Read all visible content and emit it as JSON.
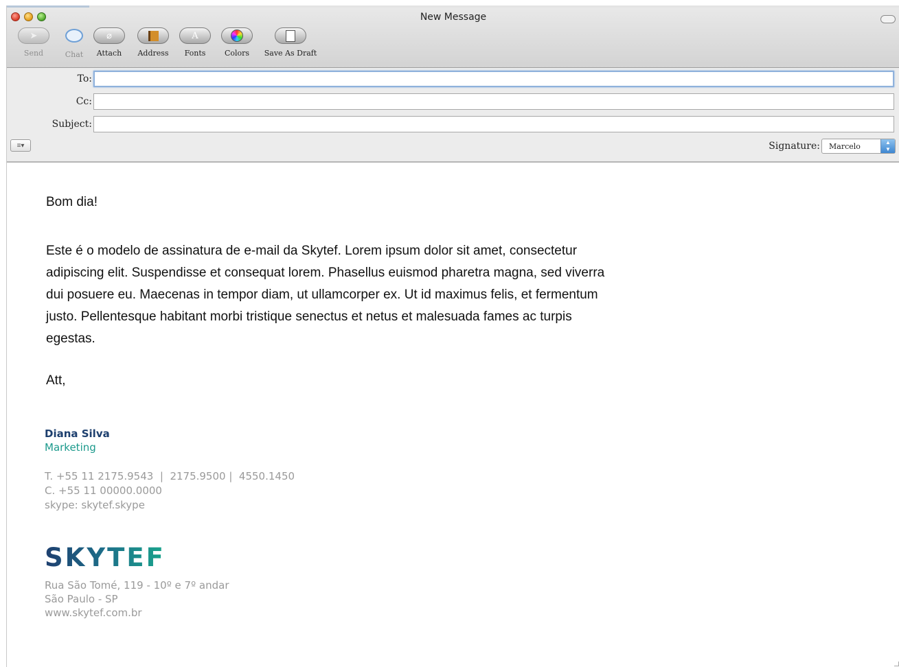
{
  "window": {
    "title": "New Message"
  },
  "toolbar": {
    "items": [
      {
        "label": "Send",
        "icon": "send-icon",
        "enabled": false
      },
      {
        "label": "Chat",
        "icon": "chat-icon",
        "enabled": false
      },
      {
        "label": "Attach",
        "icon": "paperclip-icon",
        "enabled": true
      },
      {
        "label": "Address",
        "icon": "address-book-icon",
        "enabled": true
      },
      {
        "label": "Fonts",
        "icon": "fonts-icon",
        "enabled": true
      },
      {
        "label": "Colors",
        "icon": "color-wheel-icon",
        "enabled": true
      },
      {
        "label": "Save As Draft",
        "icon": "draft-icon",
        "enabled": true
      }
    ]
  },
  "header": {
    "to_label": "To:",
    "to_value": "",
    "cc_label": "Cc:",
    "cc_value": "",
    "subject_label": "Subject:",
    "subject_value": "",
    "priority_button": "≡▾",
    "signature_label": "Signature:",
    "signature_value": "Marcelo"
  },
  "message": {
    "greeting": "Bom dia!",
    "paragraph": "Este é o modelo de assinatura de e-mail da Skytef. Lorem ipsum dolor sit amet, consectetur adipiscing elit. Suspendisse et consequat lorem. Phasellus euismod pharetra magna, sed viverra dui posuere eu. Maecenas in tempor diam, ut ullamcorper ex. Ut id maximus felis, et fermentum justo. Pellentesque habitant morbi tristique senectus et netus et malesuada fames ac turpis egestas.",
    "closing": "Att,"
  },
  "signature": {
    "name": "Diana Silva",
    "department": "Marketing",
    "phone": "T. +55 11 2175.9543  |  2175.9500 |  4550.1450",
    "cell": "C. +55 11 00000.0000",
    "skype": "skype: skytef.skype",
    "logo_text": "SKYTEF",
    "address_line1": "Rua São Tomé, 119 - 10º e 7º andar",
    "address_line2": "São Paulo - SP",
    "website": "www.skytef.com.br"
  },
  "colors": {
    "name": "#1d3f6e",
    "department": "#1c9a8c",
    "muted_text": "#9a9a9a"
  }
}
